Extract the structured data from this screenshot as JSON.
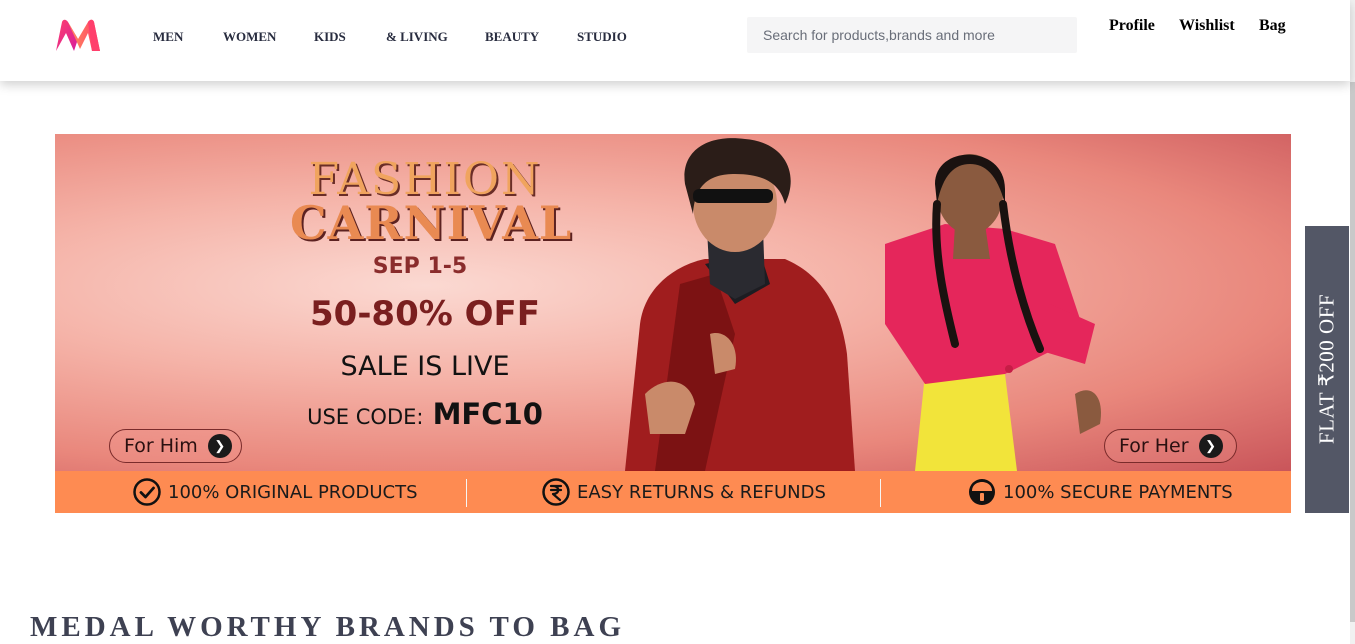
{
  "brand": {
    "logo_icon": "myntra-logo-icon",
    "colors": {
      "pink": "#ff3f6c",
      "orange": "#ff905a",
      "purple": "#d61d9d"
    }
  },
  "nav": {
    "items": [
      {
        "label": "MEN"
      },
      {
        "label": "WOMEN"
      },
      {
        "label": "KIDS"
      },
      {
        "label": "& LIVING"
      },
      {
        "label": "BEAUTY"
      },
      {
        "label": "STUDIO"
      }
    ]
  },
  "search": {
    "placeholder": "Search for products,brands and more",
    "value": ""
  },
  "user_actions": {
    "profile": "Profile",
    "wishlist": "Wishlist",
    "bag": "Bag"
  },
  "banner": {
    "title_line1": "FASHION",
    "title_line2": "CARNIVAL",
    "dates": "SEP 1-5",
    "discount": "50-80% OFF",
    "status": "SALE IS LIVE",
    "code_label": "USE CODE:",
    "code_value": "MFC10",
    "cta_him": "For Him",
    "cta_her": "For Her",
    "strip": [
      {
        "icon": "check-circle-icon",
        "text": "100% ORIGINAL PRODUCTS"
      },
      {
        "icon": "rupee-circle-icon",
        "text": "EASY RETURNS & REFUNDS"
      },
      {
        "icon": "shield-lock-icon",
        "text": "100% SECURE PAYMENTS"
      }
    ]
  },
  "side_tab": {
    "label": "FLAT ₹200 OFF"
  },
  "section": {
    "title": "MEDAL WORTHY BRANDS TO BAG"
  }
}
